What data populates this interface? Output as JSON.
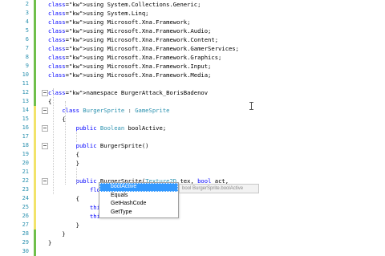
{
  "editor": {
    "lines": [
      {
        "num": "2",
        "text": "using System.Collections.Generic;",
        "mark": "green"
      },
      {
        "num": "3",
        "text": "using System.Linq;",
        "mark": "green"
      },
      {
        "num": "4",
        "text": "using Microsoft.Xna.Framework;",
        "mark": "green"
      },
      {
        "num": "5",
        "text": "using Microsoft.Xna.Framework.Audio;",
        "mark": "green"
      },
      {
        "num": "6",
        "text": "using Microsoft.Xna.Framework.Content;",
        "mark": "green"
      },
      {
        "num": "7",
        "text": "using Microsoft.Xna.Framework.GamerServices;",
        "mark": "green"
      },
      {
        "num": "8",
        "text": "using Microsoft.Xna.Framework.Graphics;",
        "mark": "green"
      },
      {
        "num": "9",
        "text": "using Microsoft.Xna.Framework.Input;",
        "mark": "green"
      },
      {
        "num": "10",
        "text": "using Microsoft.Xna.Framework.Media;",
        "mark": "green"
      },
      {
        "num": "11",
        "text": "",
        "mark": "green"
      },
      {
        "num": "12",
        "text": "namespace BurgerAttack_BorisBadenov",
        "mark": "green"
      },
      {
        "num": "13",
        "text": "{",
        "mark": "green"
      },
      {
        "num": "14",
        "text": "    class BurgerSprite : GameSprite",
        "mark": "yellow"
      },
      {
        "num": "15",
        "text": "    {",
        "mark": "yellow"
      },
      {
        "num": "16",
        "text": "        public Boolean boolActive;",
        "mark": "yellow"
      },
      {
        "num": "17",
        "text": "",
        "mark": "yellow"
      },
      {
        "num": "18",
        "text": "        public BurgerSprite()",
        "mark": "yellow"
      },
      {
        "num": "19",
        "text": "        {",
        "mark": "yellow"
      },
      {
        "num": "20",
        "text": "        }",
        "mark": "yellow"
      },
      {
        "num": "21",
        "text": "",
        "mark": "yellow"
      },
      {
        "num": "22",
        "text": "        public BurgerSprite(Texture2D tex, bool act,",
        "mark": "yellow"
      },
      {
        "num": "23",
        "text": "            float dim_X, float dim_Y)",
        "mark": "yellow"
      },
      {
        "num": "24",
        "text": "        {",
        "mark": "yellow"
      },
      {
        "num": "25",
        "text": "            this.spriteTexture = tex;",
        "mark": "yellow"
      },
      {
        "num": "26",
        "text": "            this.b",
        "mark": "yellow"
      },
      {
        "num": "27",
        "text": "        }",
        "mark": "yellow"
      },
      {
        "num": "28",
        "text": "    }",
        "mark": "green"
      },
      {
        "num": "29",
        "text": "}",
        "mark": "green"
      },
      {
        "num": "30",
        "text": "",
        "mark": "green"
      }
    ]
  },
  "intellisense": {
    "items": [
      {
        "label": "boolActive",
        "icon": "field-icon",
        "selected": true
      },
      {
        "label": "Equals",
        "icon": "method-icon",
        "selected": false
      },
      {
        "label": "GetHashCode",
        "icon": "method-icon",
        "selected": false
      },
      {
        "label": "GetType",
        "icon": "method-icon",
        "selected": false
      }
    ],
    "tooltip": "bool BurgerSprite.boolActive"
  },
  "colors": {
    "keyword": "#0000ff",
    "type": "#2b91af",
    "line_number": "#2b91af",
    "saved_marker": "#6fbf4a",
    "changed_marker": "#f2e36a",
    "selection": "#3399ff"
  }
}
